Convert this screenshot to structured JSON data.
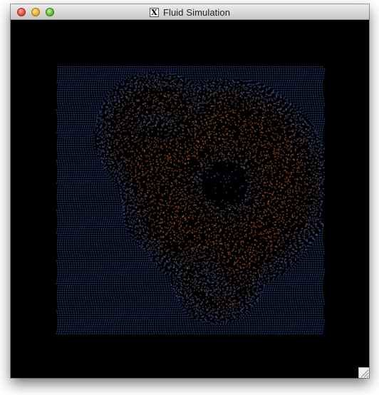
{
  "window": {
    "title": "Fluid Simulation",
    "app_icon": "x11-icon",
    "controls": [
      "close",
      "minimize",
      "maximize"
    ]
  },
  "simulation": {
    "background_color": "#000000",
    "cold_particle_color": "#4a78e6",
    "hot_particle_color": "#f07a35",
    "grip_icon": "resize-grip-icon"
  }
}
